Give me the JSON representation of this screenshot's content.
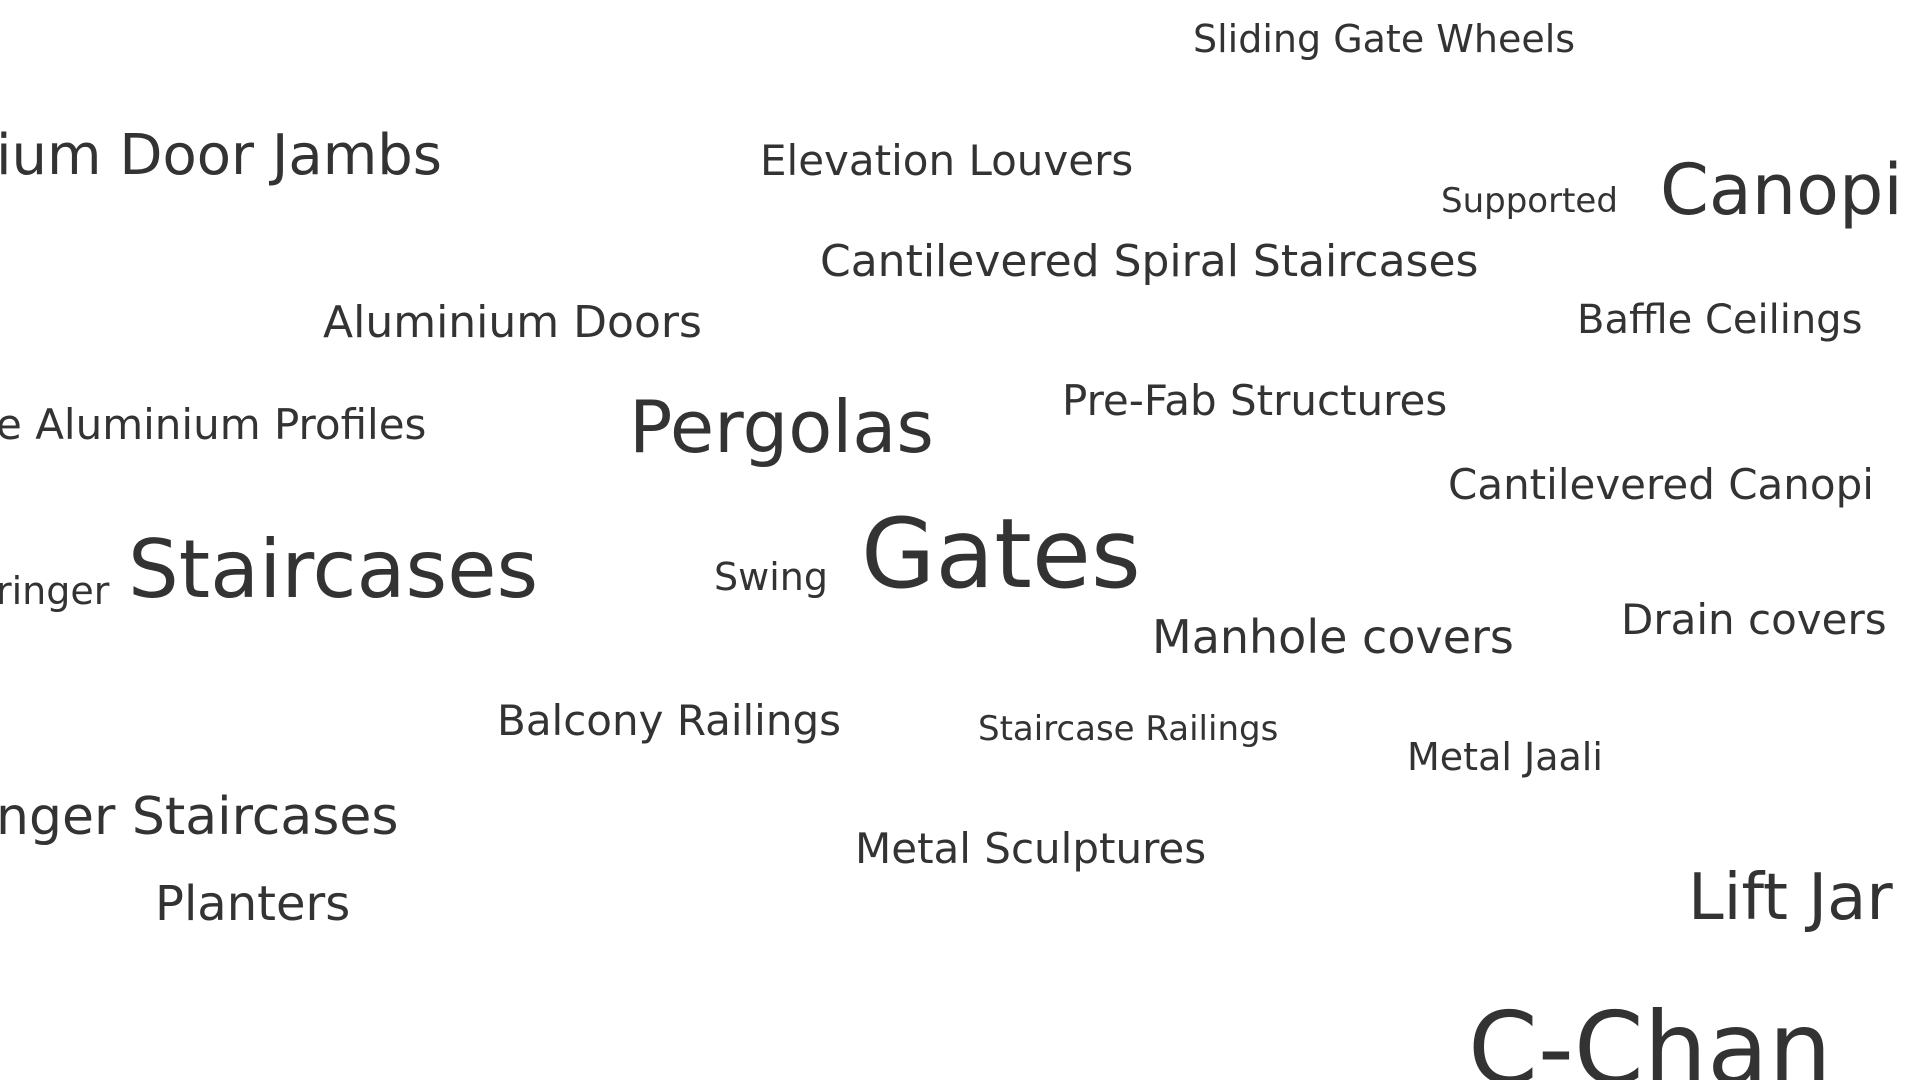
{
  "colors": {
    "background": "#ffffff",
    "text": "#333333"
  },
  "words": {
    "sliding_gate_wheels": "Sliding Gate Wheels",
    "aluminium_door_jambs": "ium Door Jambs",
    "elevation_louvers": "Elevation Louvers",
    "supported": "Supported",
    "canopies": "Canopi",
    "cantilevered_spiral_staircases": "Cantilevered Spiral Staircases",
    "aluminium_doors": "Aluminium Doors",
    "baffle_ceilings": "Baffle Ceilings",
    "aluminium_profiles": "e Aluminium Profiles",
    "pergolas": "Pergolas",
    "pre_fab_structures": "Pre-Fab Structures",
    "cantilevered_canopies": "Cantilevered Canopi",
    "stringer": "ringer",
    "staircases": "Staircases",
    "swing": "Swing",
    "gates": "Gates",
    "manhole_covers": "Manhole covers",
    "drain_covers": "Drain covers",
    "balcony_railings": "Balcony Railings",
    "staircase_railings": "Staircase Railings",
    "metal_jaali": "Metal Jaali",
    "stringer_staircases": "nger Staircases",
    "metal_sculptures": "Metal Sculptures",
    "planters": "Planters",
    "lift_jambs": "Lift Jar",
    "c_channels": "C-Chan"
  }
}
